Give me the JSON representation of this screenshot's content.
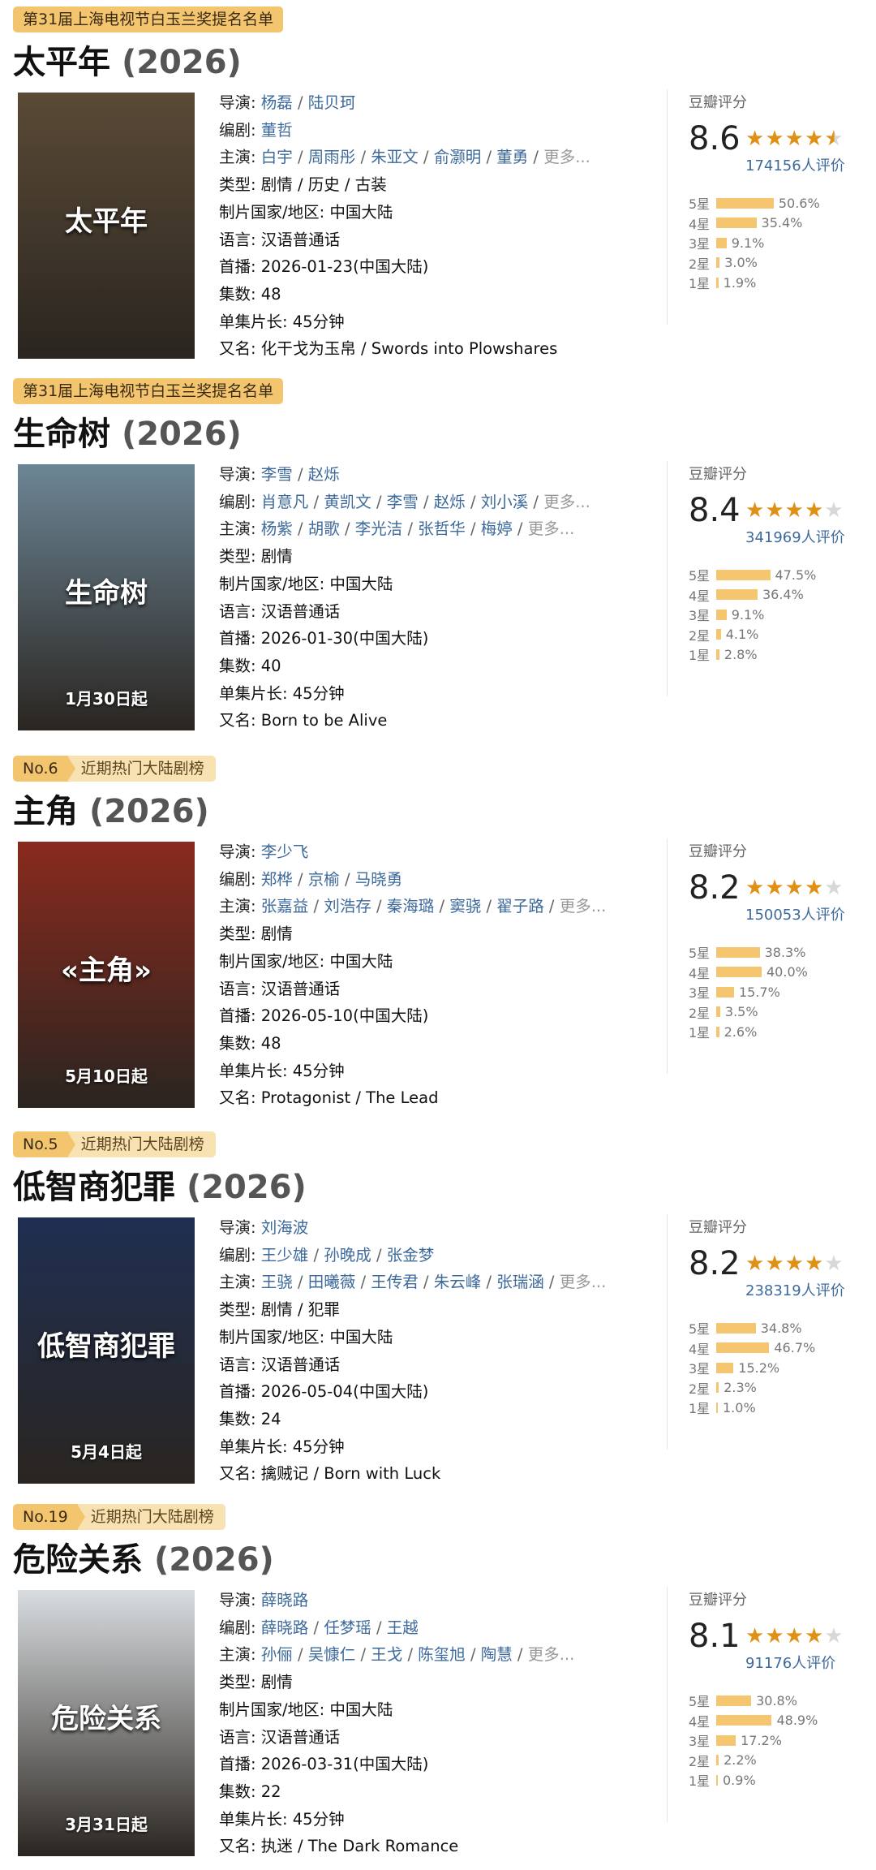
{
  "entries": [
    {
      "badge": {
        "text": "第31届上海电视节白玉兰奖提名名单"
      },
      "title": "太平年",
      "year": "(2026)",
      "director_key": "导演: ",
      "directors": [
        "杨磊",
        "陆贝珂"
      ],
      "writer_key": "编剧: ",
      "writers": [
        "董哲"
      ],
      "cast_key": "主演: ",
      "cast": [
        "白宇",
        "周雨彤",
        "朱亚文",
        "俞灏明",
        "董勇"
      ],
      "more": "更多...",
      "genre": "类型: 剧情 / 历史 / 古装",
      "region": "制片国家/地区: 中国大陆",
      "language": "语言: 汉语普通话",
      "premiere": "首播: 2026-01-23(中国大陆)",
      "episodes": "集数: 48",
      "runtime": "单集片长: 45分钟",
      "aka": "又名: 化干戈为玉帛 / Swords into Plowshares",
      "rating": {
        "label": "豆瓣评分",
        "score": "8.6",
        "stars": 4.5,
        "votes": "174156人评价",
        "dist": [
          {
            "star": "5星",
            "pct": "50.6%",
            "value": 50.6
          },
          {
            "star": "4星",
            "pct": "35.4%",
            "value": 35.4
          },
          {
            "star": "3星",
            "pct": "9.1%",
            "value": 9.1
          },
          {
            "star": "2星",
            "pct": "3.0%",
            "value": 3.0
          },
          {
            "star": "1星",
            "pct": "1.9%",
            "value": 1.9
          }
        ]
      },
      "poster": {
        "bg": "#5a4a36",
        "text": "太平年",
        "caption": ""
      }
    },
    {
      "badge": {
        "text": "第31届上海电视节白玉兰奖提名名单"
      },
      "title": "生命树",
      "year": "(2026)",
      "director_key": "导演: ",
      "directors": [
        "李雪",
        "赵烁"
      ],
      "writer_key": "编剧: ",
      "writers": [
        "肖意凡",
        "黄凯文",
        "李雪",
        "赵烁",
        "刘小溪"
      ],
      "cast_key": "主演: ",
      "cast": [
        "杨紫",
        "胡歌",
        "李光洁",
        "张哲华",
        "梅婷"
      ],
      "more": "更多...",
      "genre": "类型: 剧情",
      "region": "制片国家/地区: 中国大陆",
      "language": "语言: 汉语普通话",
      "premiere": "首播: 2026-01-30(中国大陆)",
      "episodes": "集数: 40",
      "runtime": "单集片长: 45分钟",
      "aka": "又名: Born to be Alive",
      "rating": {
        "label": "豆瓣评分",
        "score": "8.4",
        "stars": 4,
        "votes": "341969人评价",
        "dist": [
          {
            "star": "5星",
            "pct": "47.5%",
            "value": 47.5
          },
          {
            "star": "4星",
            "pct": "36.4%",
            "value": 36.4
          },
          {
            "star": "3星",
            "pct": "9.1%",
            "value": 9.1
          },
          {
            "star": "2星",
            "pct": "4.1%",
            "value": 4.1
          },
          {
            "star": "1星",
            "pct": "2.8%",
            "value": 2.8
          }
        ]
      },
      "poster": {
        "bg": "#6c8595",
        "text": "生命树",
        "caption": "1月30日起"
      }
    },
    {
      "badge": {
        "rank": "No.6",
        "text": "近期热门大陆剧榜"
      },
      "title": "主角",
      "year": "(2026)",
      "director_key": "导演: ",
      "directors": [
        "李少飞"
      ],
      "writer_key": "编剧: ",
      "writers": [
        "郑桦",
        "京榆",
        "马晓勇"
      ],
      "cast_key": "主演: ",
      "cast": [
        "张嘉益",
        "刘浩存",
        "秦海璐",
        "窦骁",
        "翟子路"
      ],
      "more": "更多...",
      "genre": "类型: 剧情",
      "region": "制片国家/地区: 中国大陆",
      "language": "语言: 汉语普通话",
      "premiere": "首播: 2026-05-10(中国大陆)",
      "episodes": "集数: 48",
      "runtime": "单集片长: 45分钟",
      "aka": "又名: Protagonist / The Lead",
      "rating": {
        "label": "豆瓣评分",
        "score": "8.2",
        "stars": 4,
        "votes": "150053人评价",
        "dist": [
          {
            "star": "5星",
            "pct": "38.3%",
            "value": 38.3
          },
          {
            "star": "4星",
            "pct": "40.0%",
            "value": 40.0
          },
          {
            "star": "3星",
            "pct": "15.7%",
            "value": 15.7
          },
          {
            "star": "2星",
            "pct": "3.5%",
            "value": 3.5
          },
          {
            "star": "1星",
            "pct": "2.6%",
            "value": 2.6
          }
        ]
      },
      "poster": {
        "bg": "#8a2a1e",
        "text": "«主角»",
        "caption": "5月10日起"
      }
    },
    {
      "badge": {
        "rank": "No.5",
        "text": "近期热门大陆剧榜"
      },
      "title": "低智商犯罪",
      "year": "(2026)",
      "director_key": "导演: ",
      "directors": [
        "刘海波"
      ],
      "writer_key": "编剧: ",
      "writers": [
        "王少雄",
        "孙晚成",
        "张金梦"
      ],
      "cast_key": "主演: ",
      "cast": [
        "王骁",
        "田曦薇",
        "王传君",
        "朱云峰",
        "张瑞涵"
      ],
      "more": "更多...",
      "genre": "类型: 剧情 / 犯罪",
      "region": "制片国家/地区: 中国大陆",
      "language": "语言: 汉语普通话",
      "premiere": "首播: 2026-05-04(中国大陆)",
      "episodes": "集数: 24",
      "runtime": "单集片长: 45分钟",
      "aka": "又名: 擒贼记 / Born with Luck",
      "rating": {
        "label": "豆瓣评分",
        "score": "8.2",
        "stars": 4,
        "votes": "238319人评价",
        "dist": [
          {
            "star": "5星",
            "pct": "34.8%",
            "value": 34.8
          },
          {
            "star": "4星",
            "pct": "46.7%",
            "value": 46.7
          },
          {
            "star": "3星",
            "pct": "15.2%",
            "value": 15.2
          },
          {
            "star": "2星",
            "pct": "2.3%",
            "value": 2.3
          },
          {
            "star": "1星",
            "pct": "1.0%",
            "value": 1.0
          }
        ]
      },
      "poster": {
        "bg": "#1f2f52",
        "text": "低智商犯罪",
        "caption": "5月4日起"
      }
    },
    {
      "badge": {
        "rank": "No.19",
        "text": "近期热门大陆剧榜"
      },
      "title": "危险关系",
      "year": "(2026)",
      "director_key": "导演: ",
      "directors": [
        "薛晓路"
      ],
      "writer_key": "编剧: ",
      "writers": [
        "薛晓路",
        "任梦瑶",
        "王越"
      ],
      "cast_key": "主演: ",
      "cast": [
        "孙俪",
        "吴慷仁",
        "王戈",
        "陈玺旭",
        "陶慧"
      ],
      "more": "更多...",
      "genre": "类型: 剧情",
      "region": "制片国家/地区: 中国大陆",
      "language": "语言: 汉语普通话",
      "premiere": "首播: 2026-03-31(中国大陆)",
      "episodes": "集数: 22",
      "runtime": "单集片长: 45分钟",
      "aka": "又名: 执迷 / The Dark Romance",
      "rating": {
        "label": "豆瓣评分",
        "score": "8.1",
        "stars": 4,
        "votes": "91176人评价",
        "dist": [
          {
            "star": "5星",
            "pct": "30.8%",
            "value": 30.8
          },
          {
            "star": "4星",
            "pct": "48.9%",
            "value": 48.9
          },
          {
            "star": "3星",
            "pct": "17.2%",
            "value": 17.2
          },
          {
            "star": "2星",
            "pct": "2.2%",
            "value": 2.2
          },
          {
            "star": "1星",
            "pct": "0.9%",
            "value": 0.9
          }
        ]
      },
      "poster": {
        "bg": "#d9dde0",
        "text": "危险关系",
        "caption": "3月31日起"
      }
    }
  ],
  "colors": {
    "link": "#3d6a9b",
    "bar": "#f5c56f",
    "star": "#e09015",
    "badge": "#f3c56e",
    "badge_light": "#f8e2b1"
  }
}
